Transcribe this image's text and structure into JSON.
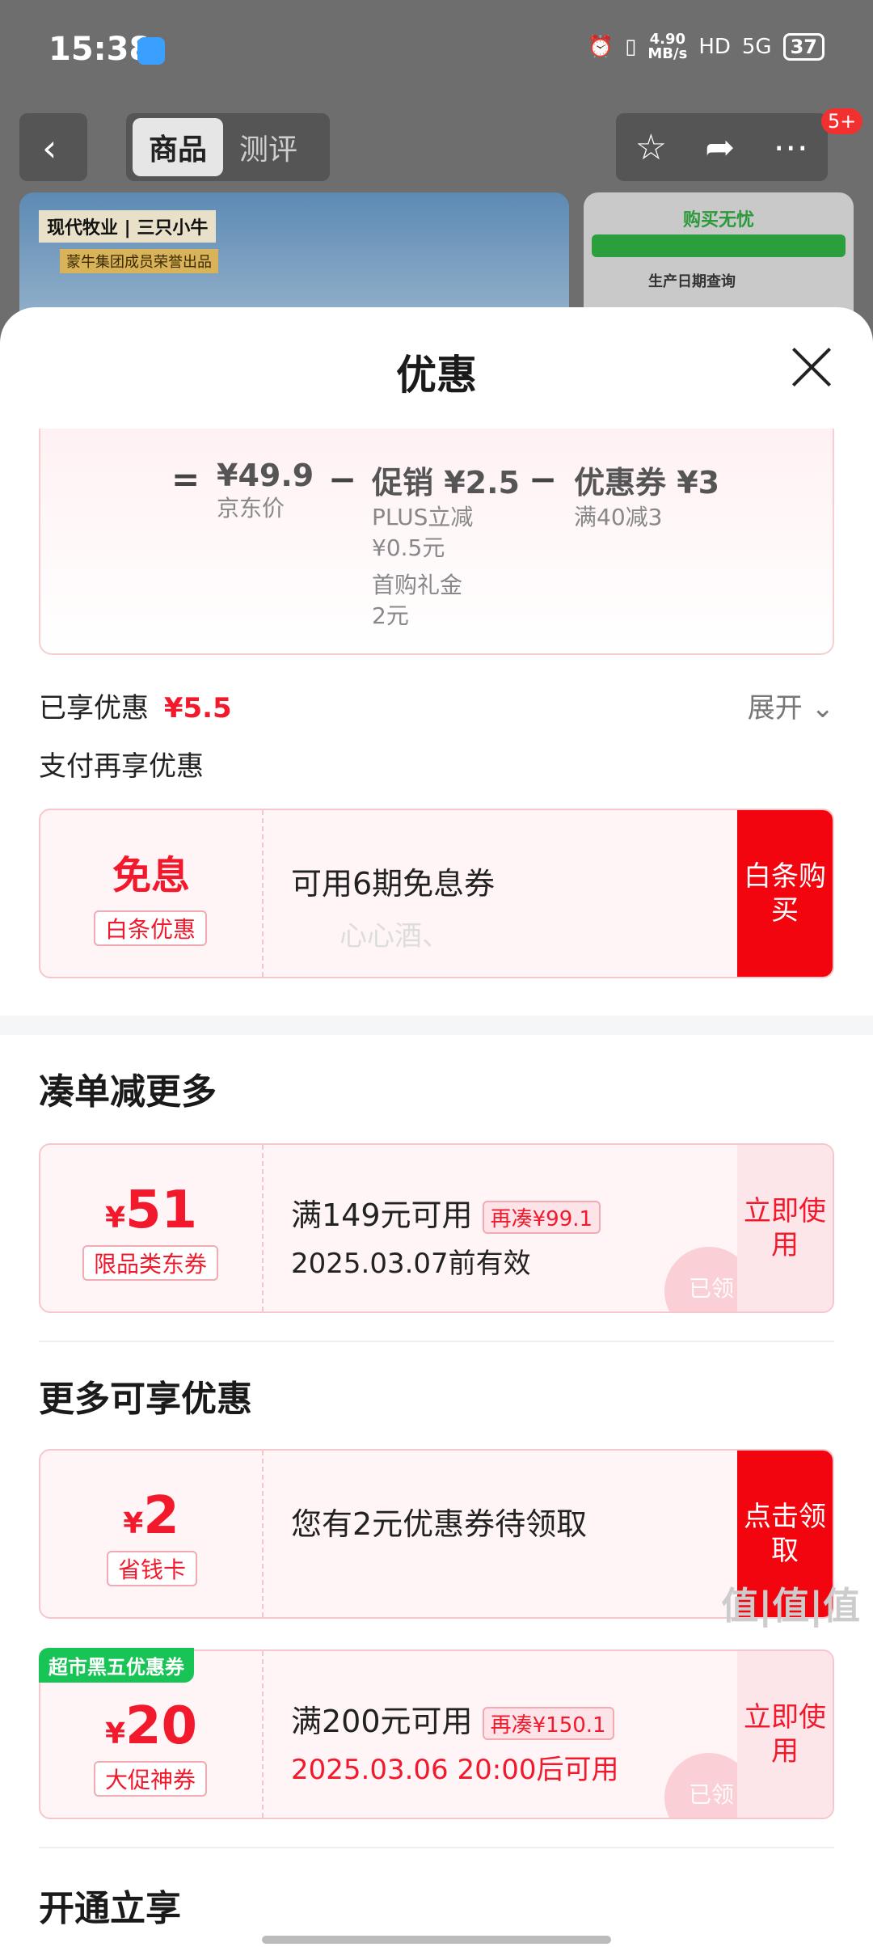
{
  "status": {
    "time": "15:38",
    "net_speed": "4.90",
    "net_unit": "MB/s",
    "hd": "HD",
    "signal": "5G",
    "battery": "37"
  },
  "nav": {
    "tabs": [
      "商品",
      "测评"
    ],
    "badge": "5+"
  },
  "banner": {
    "brand": "现代牧业 | 三只小牛",
    "sub": "蒙牛集团成员荣誉出品",
    "right_title": "购买无忧",
    "right_item": "生产日期查询"
  },
  "sheet": {
    "title": "优惠",
    "calc": {
      "eq": "=",
      "price": "¥49.9",
      "price_label": "京东价",
      "minus": "−",
      "promo": "促销 ¥2.5",
      "promo_l1": "PLUS立减",
      "promo_l2": "¥0.5元",
      "promo_l3": "首购礼金",
      "promo_l4": "2元",
      "coupon": "优惠券 ¥3",
      "coupon_label": "满40减3"
    },
    "enjoyed_label": "已享优惠",
    "enjoyed_value": "¥5.5",
    "expand": "展开",
    "pay_more": "支付再享优惠",
    "baitiao": {
      "title": "免息",
      "tag": "白条优惠",
      "desc": "可用6期免息券",
      "cta": "白条购买",
      "wm": "心心酒、"
    },
    "bundle_header": "凑单减更多",
    "bundle": {
      "currency": "¥",
      "amount": "51",
      "tag": "限品类东券",
      "line1": "满149元可用",
      "pill": "再凑¥99.1",
      "line2": "2025.03.07前有效",
      "cta": "立即使用",
      "stamp": "已领"
    },
    "more_header": "更多可享优惠",
    "saver": {
      "currency": "¥",
      "amount": "2",
      "tag": "省钱卡",
      "desc": "您有2元优惠券待领取",
      "cta": "点击领取"
    },
    "promo": {
      "corner": "超市黑五优惠券",
      "currency": "¥",
      "amount": "20",
      "tag": "大促神券",
      "line1": "满200元可用",
      "pill": "再凑¥150.1",
      "line2": "2025.03.06 20:00后可用",
      "cta": "立即使用",
      "stamp": "已领"
    },
    "open_header": "开通立享"
  },
  "watermark": "值|值|值",
  "colors": {
    "accent": "#f2192c",
    "cta": "#f2050f",
    "green": "#19c456"
  }
}
